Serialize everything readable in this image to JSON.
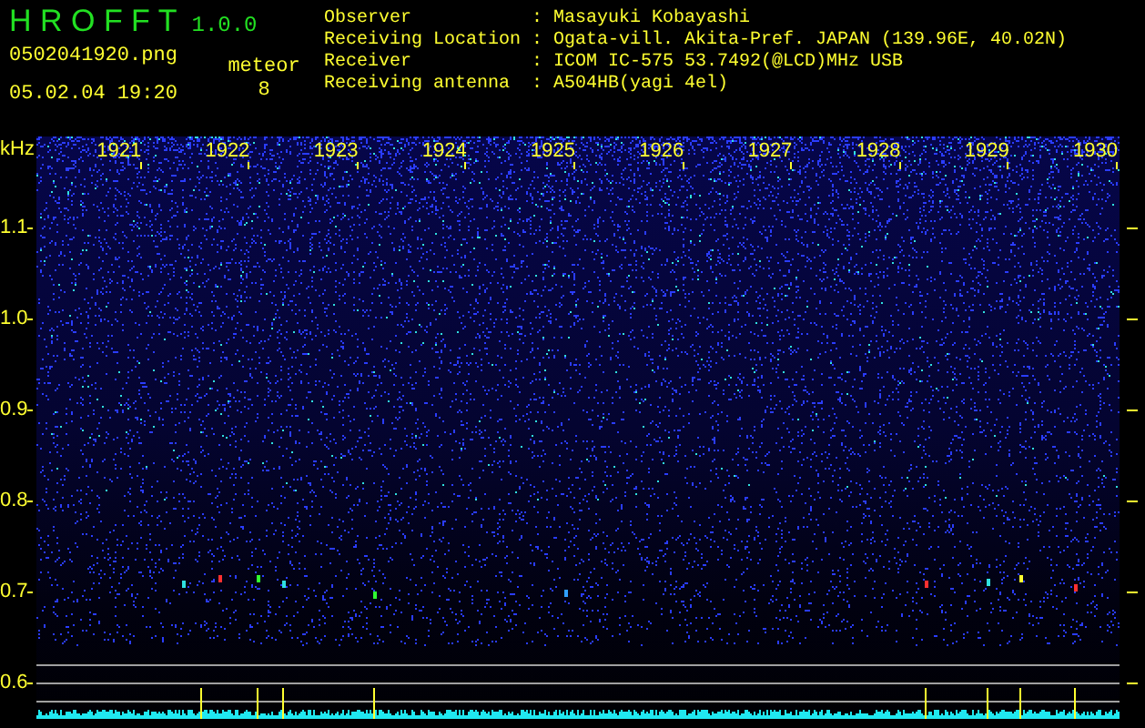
{
  "header": {
    "title": "H R O F F T",
    "version": "1.0.0",
    "filename": "0502041920.png",
    "datetime": "05.02.04 19:20",
    "meteor_label": "meteor",
    "meteor_count": "8"
  },
  "info": [
    {
      "label": "Observer",
      "separator": ":",
      "value": "Masayuki Kobayashi"
    },
    {
      "label": "Receiving Location",
      "separator": ":",
      "value": "Ogata-vill. Akita-Pref. JAPAN (139.96E, 40.02N)"
    },
    {
      "label": "Receiver",
      "separator": ":",
      "value": "ICOM IC-575 53.7492(@LCD)MHz USB"
    },
    {
      "label": "Receiving antenna",
      "separator": ":",
      "value": "A504HB(yagi 4el)"
    }
  ],
  "y_axis": {
    "unit": "kHz",
    "labels": [
      "1.1",
      "1.0",
      "0.9",
      "0.8",
      "0.7",
      "0.6"
    ]
  },
  "time_labels": [
    "1921",
    "1922",
    "1923",
    "1924",
    "1925",
    "1926",
    "1927",
    "1928",
    "1929",
    "1930"
  ]
}
